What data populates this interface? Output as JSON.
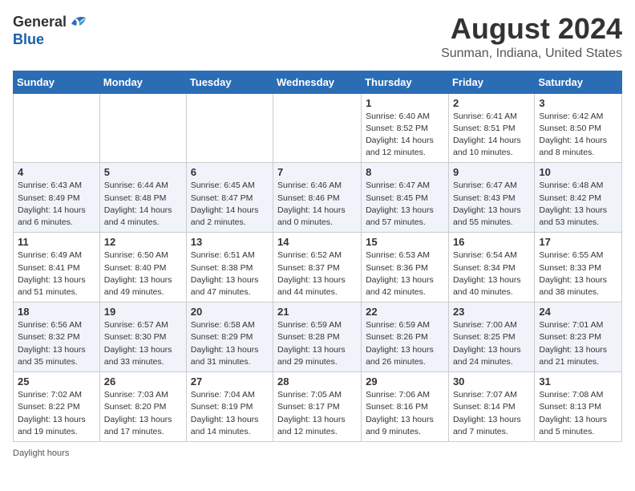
{
  "header": {
    "logo_general": "General",
    "logo_blue": "Blue",
    "main_title": "August 2024",
    "subtitle": "Sunman, Indiana, United States"
  },
  "calendar": {
    "days_of_week": [
      "Sunday",
      "Monday",
      "Tuesday",
      "Wednesday",
      "Thursday",
      "Friday",
      "Saturday"
    ],
    "weeks": [
      [
        {
          "day": "",
          "info": ""
        },
        {
          "day": "",
          "info": ""
        },
        {
          "day": "",
          "info": ""
        },
        {
          "day": "",
          "info": ""
        },
        {
          "day": "1",
          "info": "Sunrise: 6:40 AM\nSunset: 8:52 PM\nDaylight: 14 hours and 12 minutes."
        },
        {
          "day": "2",
          "info": "Sunrise: 6:41 AM\nSunset: 8:51 PM\nDaylight: 14 hours and 10 minutes."
        },
        {
          "day": "3",
          "info": "Sunrise: 6:42 AM\nSunset: 8:50 PM\nDaylight: 14 hours and 8 minutes."
        }
      ],
      [
        {
          "day": "4",
          "info": "Sunrise: 6:43 AM\nSunset: 8:49 PM\nDaylight: 14 hours and 6 minutes."
        },
        {
          "day": "5",
          "info": "Sunrise: 6:44 AM\nSunset: 8:48 PM\nDaylight: 14 hours and 4 minutes."
        },
        {
          "day": "6",
          "info": "Sunrise: 6:45 AM\nSunset: 8:47 PM\nDaylight: 14 hours and 2 minutes."
        },
        {
          "day": "7",
          "info": "Sunrise: 6:46 AM\nSunset: 8:46 PM\nDaylight: 14 hours and 0 minutes."
        },
        {
          "day": "8",
          "info": "Sunrise: 6:47 AM\nSunset: 8:45 PM\nDaylight: 13 hours and 57 minutes."
        },
        {
          "day": "9",
          "info": "Sunrise: 6:47 AM\nSunset: 8:43 PM\nDaylight: 13 hours and 55 minutes."
        },
        {
          "day": "10",
          "info": "Sunrise: 6:48 AM\nSunset: 8:42 PM\nDaylight: 13 hours and 53 minutes."
        }
      ],
      [
        {
          "day": "11",
          "info": "Sunrise: 6:49 AM\nSunset: 8:41 PM\nDaylight: 13 hours and 51 minutes."
        },
        {
          "day": "12",
          "info": "Sunrise: 6:50 AM\nSunset: 8:40 PM\nDaylight: 13 hours and 49 minutes."
        },
        {
          "day": "13",
          "info": "Sunrise: 6:51 AM\nSunset: 8:38 PM\nDaylight: 13 hours and 47 minutes."
        },
        {
          "day": "14",
          "info": "Sunrise: 6:52 AM\nSunset: 8:37 PM\nDaylight: 13 hours and 44 minutes."
        },
        {
          "day": "15",
          "info": "Sunrise: 6:53 AM\nSunset: 8:36 PM\nDaylight: 13 hours and 42 minutes."
        },
        {
          "day": "16",
          "info": "Sunrise: 6:54 AM\nSunset: 8:34 PM\nDaylight: 13 hours and 40 minutes."
        },
        {
          "day": "17",
          "info": "Sunrise: 6:55 AM\nSunset: 8:33 PM\nDaylight: 13 hours and 38 minutes."
        }
      ],
      [
        {
          "day": "18",
          "info": "Sunrise: 6:56 AM\nSunset: 8:32 PM\nDaylight: 13 hours and 35 minutes."
        },
        {
          "day": "19",
          "info": "Sunrise: 6:57 AM\nSunset: 8:30 PM\nDaylight: 13 hours and 33 minutes."
        },
        {
          "day": "20",
          "info": "Sunrise: 6:58 AM\nSunset: 8:29 PM\nDaylight: 13 hours and 31 minutes."
        },
        {
          "day": "21",
          "info": "Sunrise: 6:59 AM\nSunset: 8:28 PM\nDaylight: 13 hours and 29 minutes."
        },
        {
          "day": "22",
          "info": "Sunrise: 6:59 AM\nSunset: 8:26 PM\nDaylight: 13 hours and 26 minutes."
        },
        {
          "day": "23",
          "info": "Sunrise: 7:00 AM\nSunset: 8:25 PM\nDaylight: 13 hours and 24 minutes."
        },
        {
          "day": "24",
          "info": "Sunrise: 7:01 AM\nSunset: 8:23 PM\nDaylight: 13 hours and 21 minutes."
        }
      ],
      [
        {
          "day": "25",
          "info": "Sunrise: 7:02 AM\nSunset: 8:22 PM\nDaylight: 13 hours and 19 minutes."
        },
        {
          "day": "26",
          "info": "Sunrise: 7:03 AM\nSunset: 8:20 PM\nDaylight: 13 hours and 17 minutes."
        },
        {
          "day": "27",
          "info": "Sunrise: 7:04 AM\nSunset: 8:19 PM\nDaylight: 13 hours and 14 minutes."
        },
        {
          "day": "28",
          "info": "Sunrise: 7:05 AM\nSunset: 8:17 PM\nDaylight: 13 hours and 12 minutes."
        },
        {
          "day": "29",
          "info": "Sunrise: 7:06 AM\nSunset: 8:16 PM\nDaylight: 13 hours and 9 minutes."
        },
        {
          "day": "30",
          "info": "Sunrise: 7:07 AM\nSunset: 8:14 PM\nDaylight: 13 hours and 7 minutes."
        },
        {
          "day": "31",
          "info": "Sunrise: 7:08 AM\nSunset: 8:13 PM\nDaylight: 13 hours and 5 minutes."
        }
      ]
    ]
  },
  "footer": {
    "daylight_label": "Daylight hours"
  }
}
